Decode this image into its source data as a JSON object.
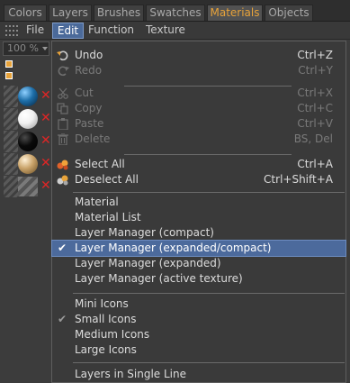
{
  "tabs": [
    {
      "label": "Colors",
      "active": false
    },
    {
      "label": "Layers",
      "active": false
    },
    {
      "label": "Brushes",
      "active": false
    },
    {
      "label": "Swatches",
      "active": false
    },
    {
      "label": "Materials",
      "active": true
    },
    {
      "label": "Objects",
      "active": false
    }
  ],
  "menubar": {
    "file": "File",
    "edit": "Edit",
    "function": "Function",
    "texture": "Texture"
  },
  "zoom": {
    "value": "100 %"
  },
  "materials": [
    {
      "color": "#1d6ea8",
      "hatched": false
    },
    {
      "color": "#f0f0f0",
      "hatched": false
    },
    {
      "color": "#0a0a0a",
      "hatched": false
    },
    {
      "color": "#c9a36a",
      "hatched": false
    },
    {
      "color": "#6a6a6a",
      "hatched": true
    }
  ],
  "menu": {
    "undo": {
      "label": "Undo",
      "shortcut": "Ctrl+Z"
    },
    "redo": {
      "label": "Redo",
      "shortcut": "Ctrl+Y"
    },
    "cut": {
      "label": "Cut",
      "shortcut": "Ctrl+X"
    },
    "copy": {
      "label": "Copy",
      "shortcut": "Ctrl+C"
    },
    "paste": {
      "label": "Paste",
      "shortcut": "Ctrl+V"
    },
    "delete": {
      "label": "Delete",
      "shortcut": "BS, Del"
    },
    "select_all": {
      "label": "Select All",
      "shortcut": "Ctrl+A"
    },
    "deselect_all": {
      "label": "Deselect All",
      "shortcut": "Ctrl+Shift+A"
    },
    "material": {
      "label": "Material"
    },
    "material_list": {
      "label": "Material List"
    },
    "lm_compact": {
      "label": "Layer Manager (compact)"
    },
    "lm_expanded_compact": {
      "label": "Layer Manager (expanded/compact)"
    },
    "lm_expanded": {
      "label": "Layer Manager (expanded)"
    },
    "lm_active_texture": {
      "label": "Layer Manager (active texture)"
    },
    "mini_icons": {
      "label": "Mini Icons"
    },
    "small_icons": {
      "label": "Small Icons"
    },
    "medium_icons": {
      "label": "Medium Icons"
    },
    "large_icons": {
      "label": "Large Icons"
    },
    "layers_single_line": {
      "label": "Layers in Single Line"
    }
  },
  "colors": {
    "accent": "#e8a33a",
    "highlight": "#4c6a9c",
    "delete_mark": "#e02525"
  }
}
